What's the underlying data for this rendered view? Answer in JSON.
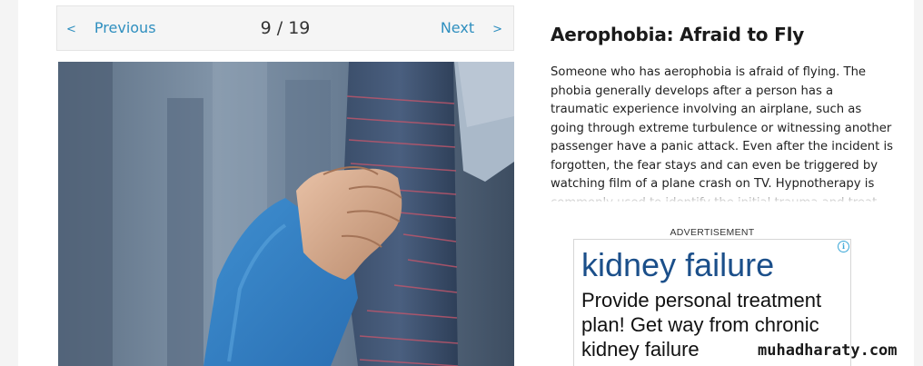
{
  "pager": {
    "prev_chevron": "<",
    "prev_label": "Previous",
    "counter": "9 / 19",
    "next_label": "Next",
    "next_chevron": ">"
  },
  "article": {
    "title": "Aerophobia: Afraid to Fly",
    "description": "Someone who has aerophobia is afraid of flying. The phobia generally develops after a person has a traumatic experience involving an airplane, such as going through extreme turbulence or witnessing another passenger have a panic attack. Even after the incident is forgotten, the fear stays and can even be triggered by watching film of a plane crash on TV. Hypnotherapy is commonly used to identify the initial trauma and treat this phobia."
  },
  "advertisement": {
    "label": "ADVERTISEMENT",
    "info_glyph": "i",
    "headline": "kidney failure",
    "body": "Provide personal treatment plan! Get way from chronic kidney failure"
  },
  "watermark": "muhadharaty.com",
  "colors": {
    "link": "#2f8fbf",
    "ad_headline": "#1b4f8a"
  },
  "icons": {
    "prev": "chevron-left-icon",
    "next": "chevron-right-icon",
    "ad_info": "info-icon"
  }
}
